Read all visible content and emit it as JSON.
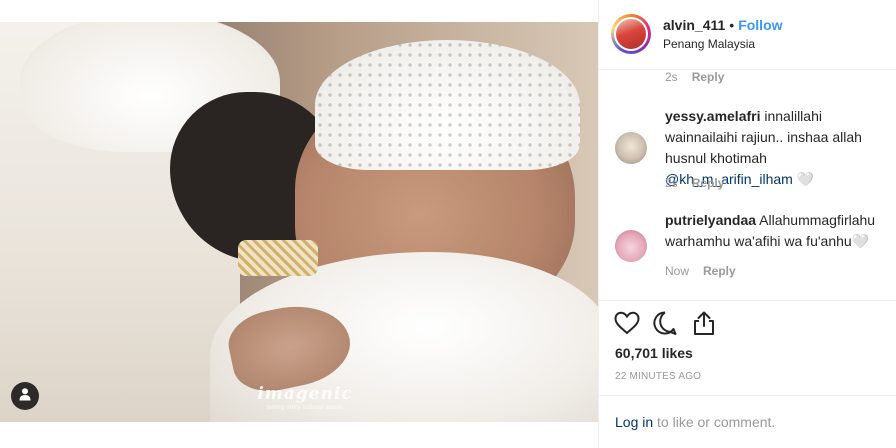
{
  "photo": {
    "watermark_title": "imagenic",
    "watermark_subtitle": "telling story without words"
  },
  "header": {
    "username": "alvin_411",
    "separator": "•",
    "follow_label": "Follow",
    "location": "Penang Malaysia"
  },
  "comments": [
    {
      "username": "",
      "text": "",
      "time": "2s",
      "reply_label": "Reply"
    },
    {
      "username": "yessy.amelafri",
      "text_before": " innalillahi wainnailaihi rajiun.. inshaa allah husnul khotimah ",
      "mention": "@kh_m_arifin_ilham",
      "text_after": " 🤍",
      "time": "2s",
      "reply_label": "Reply"
    },
    {
      "username": "putrielyandaa",
      "text": " Allahummagfirlahu warhamhu wa'afihi wa fu'anhu🤍",
      "time": "Now",
      "reply_label": "Reply"
    }
  ],
  "actions": {
    "likes": "60,701 likes",
    "time_ago": "22 MINUTES AGO"
  },
  "login": {
    "link_label": "Log in",
    "rest": " to like or comment."
  },
  "colors": {
    "link_blue": "#3897f0",
    "mention_blue": "#003569",
    "muted_gray": "#999999"
  }
}
